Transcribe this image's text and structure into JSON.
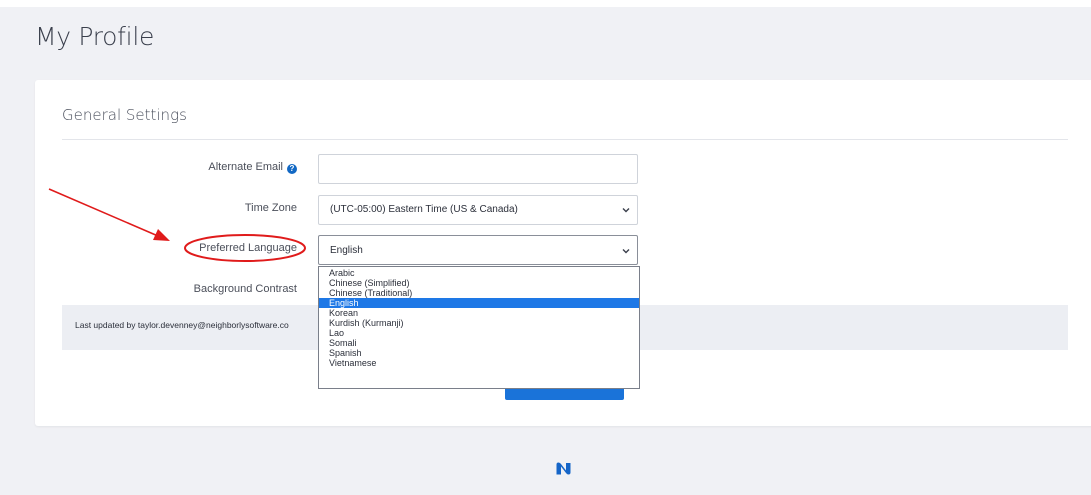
{
  "page": {
    "title": "My Profile"
  },
  "general_settings": {
    "title": "General Settings",
    "alternate_email": {
      "label": "Alternate Email",
      "value": "",
      "placeholder": "",
      "help_icon": "question-circle-icon"
    },
    "time_zone": {
      "label": "Time Zone",
      "selected": "(UTC-05:00) Eastern Time (US & Canada)"
    },
    "preferred_language": {
      "label": "Preferred Language",
      "selected": "English",
      "options": [
        "Arabic",
        "Chinese (Simplified)",
        "Chinese (Traditional)",
        "English",
        "Korean",
        "Kurdish (Kurmanji)",
        "Lao",
        "Somali",
        "Spanish",
        "Vietnamese"
      ],
      "selected_index": 3
    },
    "background_contrast": {
      "label": "Background Contrast"
    },
    "last_updated": "Last updated by taylor.devenney@neighborlysoftware.co"
  },
  "colors": {
    "accent": "#1a73d9",
    "annotation": "#e01b1b",
    "selected_option": "#1e78e6"
  },
  "icons": {
    "logo": "neighborly-n-logo-icon",
    "chevron": "chevron-down-icon",
    "help": "question-circle-icon"
  }
}
